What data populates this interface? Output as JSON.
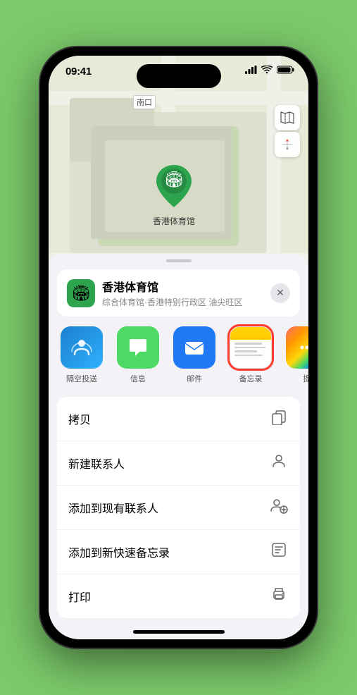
{
  "status": {
    "time": "09:41",
    "location_arrow": "▶",
    "signal_bars": "●●●",
    "wifi": "WiFi",
    "battery": "Battery"
  },
  "map": {
    "label_nankou": "南口",
    "map_icon": "🗺",
    "location_icon": "⬆"
  },
  "venue": {
    "name": "香港体育馆",
    "subtitle": "综合体育馆·香港特别行政区 油尖旺区",
    "icon": "🏟",
    "close": "✕"
  },
  "share_items": [
    {
      "id": "airdrop",
      "label": "隔空投送",
      "icon_class": "icon-airdrop",
      "icon_char": "📡",
      "selected": false
    },
    {
      "id": "message",
      "label": "信息",
      "icon_class": "icon-message",
      "icon_char": "💬",
      "selected": false
    },
    {
      "id": "mail",
      "label": "邮件",
      "icon_class": "icon-mail",
      "icon_char": "✉",
      "selected": false
    },
    {
      "id": "notes",
      "label": "备忘录",
      "icon_class": "icon-notes",
      "icon_char": "",
      "selected": true
    },
    {
      "id": "more",
      "label": "提",
      "icon_class": "icon-more",
      "icon_char": "⋯",
      "selected": false
    }
  ],
  "actions": [
    {
      "id": "copy",
      "label": "拷贝",
      "icon": "⎘"
    },
    {
      "id": "new-contact",
      "label": "新建联系人",
      "icon": "👤"
    },
    {
      "id": "add-existing",
      "label": "添加到现有联系人",
      "icon": "👤"
    },
    {
      "id": "add-notes",
      "label": "添加到新快速备忘录",
      "icon": "📋"
    },
    {
      "id": "print",
      "label": "打印",
      "icon": "🖨"
    }
  ]
}
